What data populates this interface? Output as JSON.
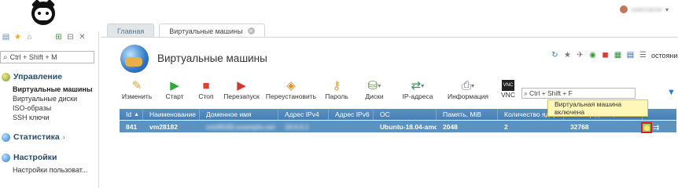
{
  "app": {
    "user_name": "username"
  },
  "sidebar": {
    "search_placeholder": "Ctrl + Shift + M",
    "sections": {
      "management": {
        "title": "Управление",
        "items": [
          "Виртуальные машины",
          "Виртуальные диски",
          "ISO-образы",
          "SSH ключи"
        ]
      },
      "statistics": {
        "title": "Статистика"
      },
      "settings": {
        "title": "Настройки",
        "items": [
          "Настройки пользоват..."
        ]
      }
    }
  },
  "tabs": [
    {
      "label": "Главная"
    },
    {
      "label": "Виртуальные машины"
    }
  ],
  "main": {
    "title": "Виртуальные машины",
    "more_label": "остояние",
    "search_placeholder": "Ctrl + Shift + F",
    "actions": [
      {
        "label": "Изменить",
        "icon": "edit-icon"
      },
      {
        "label": "Старт",
        "icon": "play-icon"
      },
      {
        "label": "Стоп",
        "icon": "stop-icon"
      },
      {
        "label": "Перезапуск",
        "icon": "restart-icon"
      },
      {
        "label": "Переустановить",
        "icon": "reinstall-icon"
      },
      {
        "label": "Пароль",
        "icon": "key-icon"
      },
      {
        "label": "Диски",
        "icon": "disk-icon"
      },
      {
        "label": "IP-адреса",
        "icon": "ip-icon"
      },
      {
        "label": "Информация",
        "icon": "info-icon"
      },
      {
        "label": "VNC",
        "icon": "vnc-icon"
      }
    ],
    "table": {
      "columns": [
        "Id",
        "Наименование",
        "Доменное имя",
        "Адрес IPv4",
        "Адрес IPv6",
        "ОС",
        "Память, MiB",
        "Количество ядер",
        "Размер диска, MiB",
        ""
      ],
      "rows": [
        [
          "841",
          "vm28182",
          "vm28182.example.net",
          "10.0.0.1",
          "",
          "Ubuntu-18.04-amd64",
          "2048",
          "2",
          "32768",
          ""
        ]
      ]
    },
    "tooltip": "Виртуальная машина включена"
  }
}
